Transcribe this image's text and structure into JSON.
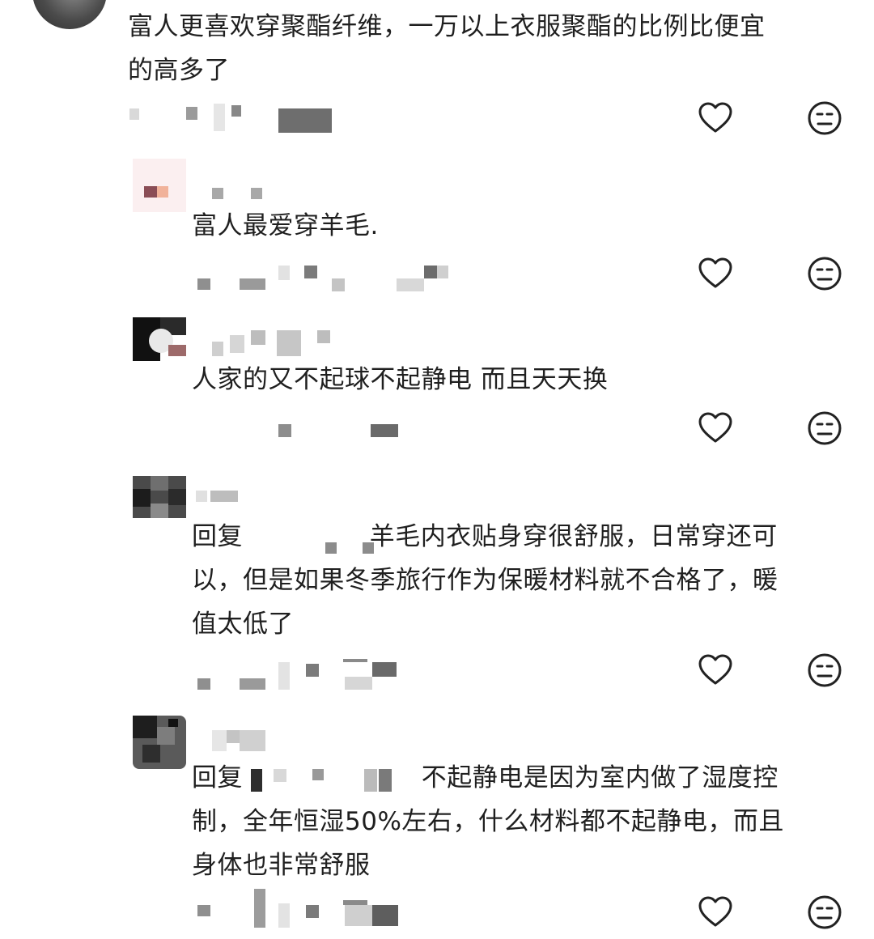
{
  "comments": [
    {
      "text_lines": [
        "富人更喜欢穿聚酯纤维，一万以上衣服聚酯的比例比便宜",
        "的高多了"
      ]
    },
    {
      "text_lines": [
        "富人最爱穿羊毛."
      ]
    },
    {
      "text_lines": [
        "人家的又不起球不起静电 而且天天换"
      ]
    },
    {
      "reply_prefix": "回复",
      "text_lines": [
        "羊毛内衣贴身穿很舒服，日常穿还可",
        "以，但是如果冬季旅行作为保暖材料就不合格了，暖",
        "值太低了"
      ]
    },
    {
      "reply_prefix": "回复",
      "text_lines": [
        "不起静电是因为室内做了湿度控",
        "制，全年恒湿50%左右，什么材料都不起静电，而且",
        "身体也非常舒服"
      ]
    }
  ],
  "icons": {
    "like": "heart-outline-icon",
    "dislike": "neutral-face-icon"
  },
  "colors": {
    "text": "#1f1f1f",
    "icon": "#222222",
    "blur": "#9a9a9a"
  }
}
